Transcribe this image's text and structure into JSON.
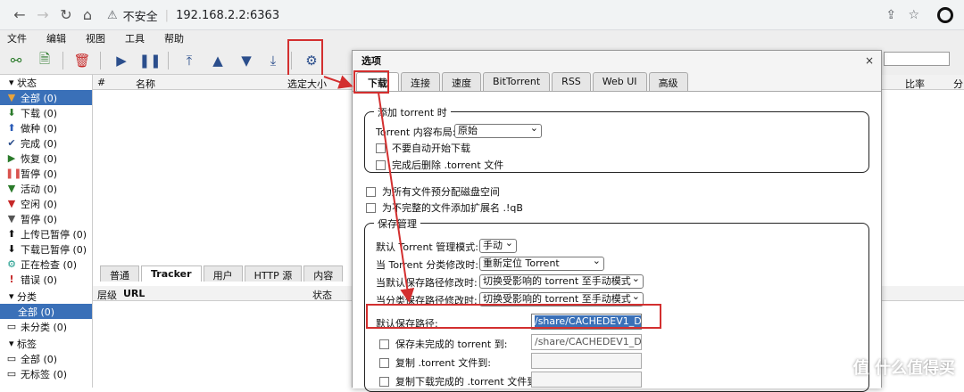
{
  "browser": {
    "warning_text": "不安全",
    "address": "192.168.2.2:6363"
  },
  "menu": [
    "文件",
    "编辑",
    "视图",
    "工具",
    "帮助"
  ],
  "sidebar": {
    "status_header": "状态",
    "status_items": [
      {
        "label": "全部 (0)",
        "icon": "filter-icon",
        "selected": true
      },
      {
        "label": "下载 (0)",
        "icon": "down-arrow-icon"
      },
      {
        "label": "做种 (0)",
        "icon": "up-arrow-icon"
      },
      {
        "label": "完成 (0)",
        "icon": "check-icon"
      },
      {
        "label": "恢复 (0)",
        "icon": "play-icon"
      },
      {
        "label": "暂停 (0)",
        "icon": "pause-icon"
      },
      {
        "label": "活动 (0)",
        "icon": "filter-icon"
      },
      {
        "label": "空闲 (0)",
        "icon": "filter-icon"
      },
      {
        "label": "暂停 (0)",
        "icon": "filter-icon"
      },
      {
        "label": "上传已暂停 (0)",
        "icon": "up-arrow-icon"
      },
      {
        "label": "下载已暂停 (0)",
        "icon": "down-arrow-icon"
      },
      {
        "label": "正在检查 (0)",
        "icon": "gear-icon"
      },
      {
        "label": "错误 (0)",
        "icon": "error-icon"
      }
    ],
    "category_header": "分类",
    "category_items": [
      {
        "label": "全部 (0)",
        "selected": true
      },
      {
        "label": "未分类 (0)"
      }
    ],
    "tag_header": "标签",
    "tag_items": [
      {
        "label": "全部 (0)"
      },
      {
        "label": "无标签 (0)"
      }
    ]
  },
  "torrent_table": {
    "col_num": "#",
    "col_name": "名称",
    "col_size": "选定大小",
    "col_ratio": "比率",
    "col_extra": "分"
  },
  "bottom_panel": {
    "tabs": [
      "普通",
      "Tracker",
      "用户",
      "HTTP 源",
      "内容"
    ],
    "active_tab": 1,
    "col_tier": "层级",
    "col_url": "URL",
    "col_status": "状态"
  },
  "dialog": {
    "title": "选项",
    "close": "×",
    "tabs": [
      "下载",
      "连接",
      "速度",
      "BitTorrent",
      "RSS",
      "Web UI",
      "高级"
    ],
    "add_torrent": {
      "legend": "添加 torrent 时",
      "layout_label": "Torrent 内容布局:",
      "layout_value": "原始",
      "no_autostart": "不要自动开始下载",
      "delete_torrent": "完成后删除 .torrent 文件"
    },
    "prealloc": "为所有文件预分配磁盘空间",
    "append_ext": "为不完整的文件添加扩展名 .!qB",
    "save_mgmt": {
      "legend": "保存管理",
      "mode_label": "默认 Torrent 管理模式:",
      "mode_value": "手动",
      "cat_changed_label": "当 Torrent 分类修改时:",
      "cat_changed_value": "重新定位 Torrent",
      "default_path_changed_label": "当默认保存路径修改时:",
      "default_path_changed_value": "切换受影响的 torrent 至手动模式",
      "cat_path_changed_label": "当分类保存路径修改时:",
      "cat_path_changed_value": "切换受影响的 torrent 至手动模式",
      "default_path_label": "默认保存路径:",
      "default_path_value": "/share/CACHEDEV1_D",
      "incomplete_label": "保存未完成的 torrent 到:",
      "incomplete_value": "/share/CACHEDEV1_D",
      "copy_torrent_label": "复制 .torrent 文件到:",
      "copy_finished_label": "复制下载完成的 .torrent 文件到:"
    }
  },
  "watermark": "值 什么值得买"
}
